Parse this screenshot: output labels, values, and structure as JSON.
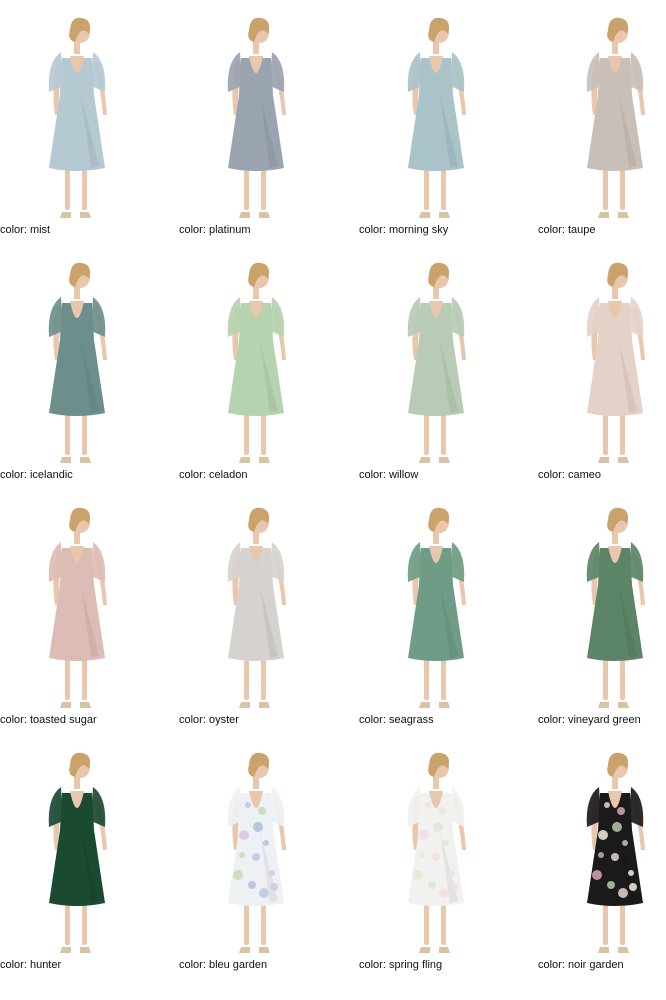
{
  "swatches": [
    {
      "label": "color: mist",
      "dress": "#b5c9d3",
      "pattern": "solid"
    },
    {
      "label": "color: platinum",
      "dress": "#9aa3b0",
      "pattern": "solid"
    },
    {
      "label": "color: morning sky",
      "dress": "#a9c3c8",
      "pattern": "solid"
    },
    {
      "label": "color: taupe",
      "dress": "#c8bfb8",
      "pattern": "solid"
    },
    {
      "label": "color: icelandic",
      "dress": "#6d8f8c",
      "pattern": "solid"
    },
    {
      "label": "color: celadon",
      "dress": "#b5d3b0",
      "pattern": "solid"
    },
    {
      "label": "color: willow",
      "dress": "#b7cbb5",
      "pattern": "solid"
    },
    {
      "label": "color: cameo",
      "dress": "#e4d2c9",
      "pattern": "solid"
    },
    {
      "label": "color: toasted sugar",
      "dress": "#dcbdb5",
      "pattern": "solid"
    },
    {
      "label": "color: oyster",
      "dress": "#d6d2cf",
      "pattern": "solid"
    },
    {
      "label": "color: seagrass",
      "dress": "#6f9c86",
      "pattern": "solid"
    },
    {
      "label": "color: vineyard green",
      "dress": "#5c8466",
      "pattern": "solid"
    },
    {
      "label": "color: hunter",
      "dress": "#1b4a33",
      "pattern": "solid"
    },
    {
      "label": "color: bleu garden",
      "dress": "#eef1f4",
      "pattern": "floral-light"
    },
    {
      "label": "color: spring fling",
      "dress": "#f1f1ef",
      "pattern": "floral-pale"
    },
    {
      "label": "color: noir garden",
      "dress": "#1a1a1a",
      "pattern": "floral-dark"
    }
  ],
  "colors": {
    "skin": "#e9c7ad",
    "hair": "#c9a36b",
    "shoe": "#d8c3a5"
  }
}
